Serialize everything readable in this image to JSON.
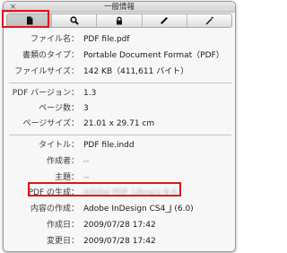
{
  "window": {
    "title": "一般情報",
    "close_glyph": "×"
  },
  "toolbar": {
    "tabs": [
      {
        "icon": "document-icon",
        "active": true
      },
      {
        "icon": "search-icon",
        "active": false
      },
      {
        "icon": "lock-icon",
        "active": false
      },
      {
        "icon": "ruler-icon",
        "active": false
      },
      {
        "icon": "pen-icon",
        "active": false
      }
    ]
  },
  "file": {
    "name_label": "ファイル名：",
    "name": "PDF file.pdf",
    "type_label": "書類のタイプ：",
    "type": "Portable Document Format（PDF）",
    "size_label": "ファイルサイズ：",
    "size": "142 KB（411,611 バイト）"
  },
  "pdf": {
    "version_label": "PDF バージョン：",
    "version": "1.3",
    "pages_label": "ページ数：",
    "pages": "3",
    "page_size_label": "ページサイズ：",
    "page_size": "21.01 x 29.71 cm"
  },
  "meta": {
    "title_label": "タイトル：",
    "title": "PDF file.indd",
    "author_label": "作成者：",
    "author": "--",
    "subject_label": "主題：",
    "subject": "--",
    "producer_label": "PDF の生成：",
    "producer": "Adobe PDF Library 9.0",
    "creator_label": "内容の作成：",
    "creator": "Adobe InDesign CS4_J (6.0)",
    "created_label": "作成日：",
    "created": "2009/07/28 17:42",
    "modified_label": "変更日：",
    "modified": "2009/07/28 17:42"
  }
}
